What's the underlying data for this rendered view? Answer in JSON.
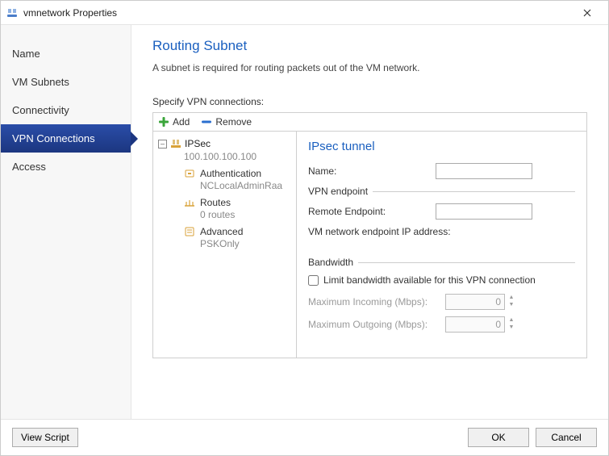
{
  "window": {
    "title": "vmnetwork Properties"
  },
  "sidebar": {
    "items": [
      {
        "label": "Name"
      },
      {
        "label": "VM Subnets"
      },
      {
        "label": "Connectivity"
      },
      {
        "label": "VPN Connections"
      },
      {
        "label": "Access"
      }
    ]
  },
  "main": {
    "heading": "Routing Subnet",
    "description": "A subnet is required for routing packets out of the VM network.",
    "specify_label": "Specify VPN connections:",
    "toolbar": {
      "add": "Add",
      "remove": "Remove"
    },
    "tree": {
      "root_label": "IPSec",
      "root_sub": "100.100.100.100",
      "expander": "–",
      "children": [
        {
          "label": "Authentication",
          "sub": "NCLocalAdminRaa"
        },
        {
          "label": "Routes",
          "sub": "0 routes"
        },
        {
          "label": "Advanced",
          "sub": "PSKOnly"
        }
      ]
    },
    "detail": {
      "heading": "IPsec tunnel",
      "name_label": "Name:",
      "name_value": "",
      "vpn_endpoint_group": "VPN endpoint",
      "remote_label": "Remote Endpoint:",
      "remote_value": "",
      "vm_endpoint_label": "VM network endpoint IP address:",
      "bandwidth_group": "Bandwidth",
      "limit_checkbox_label": "Limit bandwidth available for this VPN connection",
      "max_in_label": "Maximum Incoming (Mbps):",
      "max_in_value": "0",
      "max_out_label": "Maximum Outgoing (Mbps):",
      "max_out_value": "0"
    }
  },
  "footer": {
    "view_script": "View Script",
    "ok": "OK",
    "cancel": "Cancel"
  }
}
